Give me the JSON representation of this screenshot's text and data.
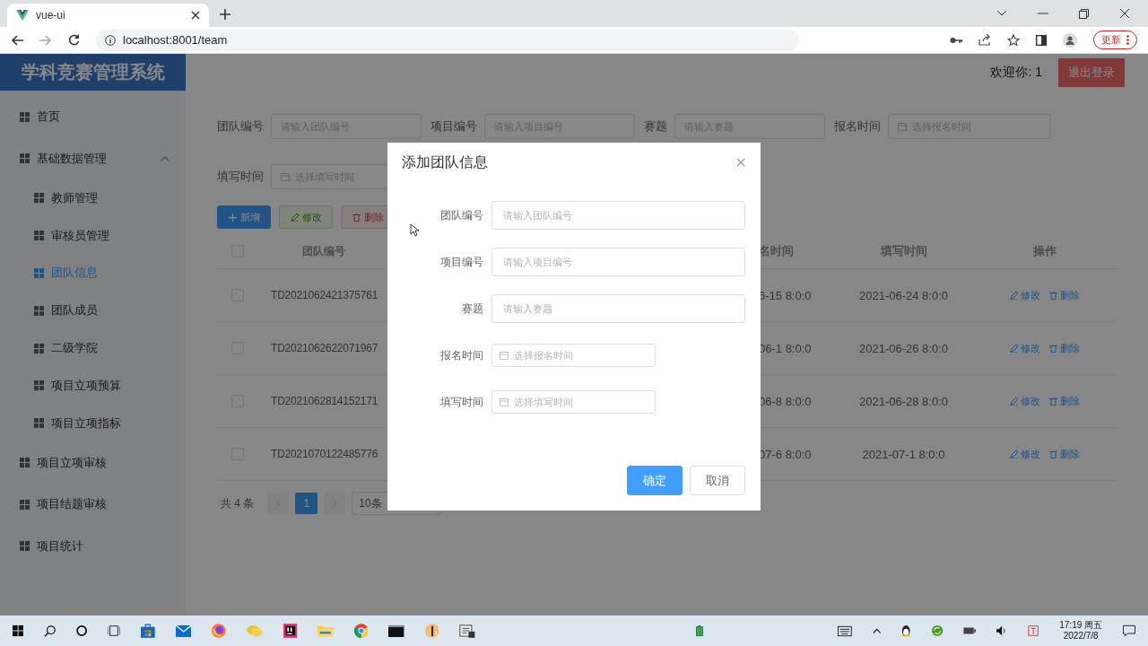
{
  "browser": {
    "tab_title": "vue-ui",
    "address": "localhost:8001/team",
    "update_button": "更新"
  },
  "header": {
    "logo": "学科竞赛管理系统",
    "welcome": "欢迎你: 1",
    "logout": "退出登录"
  },
  "sidebar": {
    "items": [
      {
        "label": "首页",
        "kind": "link",
        "selected": false
      },
      {
        "label": "基础数据管理",
        "kind": "group",
        "selected": false,
        "expanded": true,
        "children": [
          {
            "label": "教师管理",
            "selected": false
          },
          {
            "label": "审核员管理",
            "selected": false
          },
          {
            "label": "团队信息",
            "selected": true
          },
          {
            "label": "团队成员",
            "selected": false
          },
          {
            "label": "二级学院",
            "selected": false
          },
          {
            "label": "项目立项预算",
            "selected": false
          },
          {
            "label": "项目立项指标",
            "selected": false
          }
        ]
      },
      {
        "label": "项目立项审核",
        "kind": "link",
        "selected": false
      },
      {
        "label": "项目结题审核",
        "kind": "link",
        "selected": false
      },
      {
        "label": "项目统计",
        "kind": "link",
        "selected": false
      }
    ]
  },
  "filters": [
    {
      "label": "团队编号",
      "placeholder": "请输入团队编号",
      "kind": "text"
    },
    {
      "label": "项目编号",
      "placeholder": "请输入项目编号",
      "kind": "text"
    },
    {
      "label": "赛题",
      "placeholder": "请输入赛题",
      "kind": "text"
    },
    {
      "label": "报名时间",
      "placeholder": "选择报名时间",
      "kind": "date"
    },
    {
      "label": "填写时间",
      "placeholder": "选择填写时间",
      "kind": "date"
    }
  ],
  "toolbar": [
    {
      "label": "新增",
      "kind": "add",
      "disabled": false
    },
    {
      "label": "修改",
      "kind": "edit",
      "disabled": true
    },
    {
      "label": "删除",
      "kind": "delete",
      "disabled": true
    }
  ],
  "table": {
    "columns": [
      "团队编号",
      "名时间",
      "填写时间",
      "操作"
    ],
    "header_checked": false,
    "rows": [
      {
        "checked": false,
        "cells": [
          "TD2021062421375761",
          "6-15 8:0:0",
          "2021-06-24 8:0:0"
        ],
        "actions": [
          "修改",
          "删除"
        ]
      },
      {
        "checked": false,
        "cells": [
          "TD2021062622071967",
          "06-1 8:0:0",
          "2021-06-26 8:0:0"
        ],
        "actions": [
          "修改",
          "删除"
        ]
      },
      {
        "checked": false,
        "cells": [
          "TD2021062814152171",
          "06-8 8:0:0",
          "2021-06-28 8:0:0"
        ],
        "actions": [
          "修改",
          "删除"
        ]
      },
      {
        "checked": false,
        "cells": [
          "TD2021070122485776",
          "07-6 8:0:0",
          "2021-07-1 8:0:0"
        ],
        "actions": [
          "修改",
          "删除"
        ]
      }
    ]
  },
  "pagination": {
    "total": "共 4 条",
    "pages": [
      {
        "label": "1",
        "selected": true
      }
    ],
    "page_size": "10条"
  },
  "dialog": {
    "title": "添加团队信息",
    "fields": [
      {
        "label": "团队编号",
        "placeholder": "请输入团队编号",
        "kind": "text"
      },
      {
        "label": "项目编号",
        "placeholder": "请输入项目编号",
        "kind": "text"
      },
      {
        "label": "赛题",
        "placeholder": "请输入赛题",
        "kind": "text"
      },
      {
        "label": "报名时间",
        "placeholder": "选择报名时间",
        "kind": "date"
      },
      {
        "label": "填写时间",
        "placeholder": "选择填写时间",
        "kind": "date"
      }
    ],
    "buttons": [
      {
        "label": "确定",
        "kind": "primary"
      },
      {
        "label": "取消",
        "kind": "default"
      }
    ]
  },
  "taskbar": {
    "time": "17:19 周五",
    "date": "2022/7/8"
  }
}
